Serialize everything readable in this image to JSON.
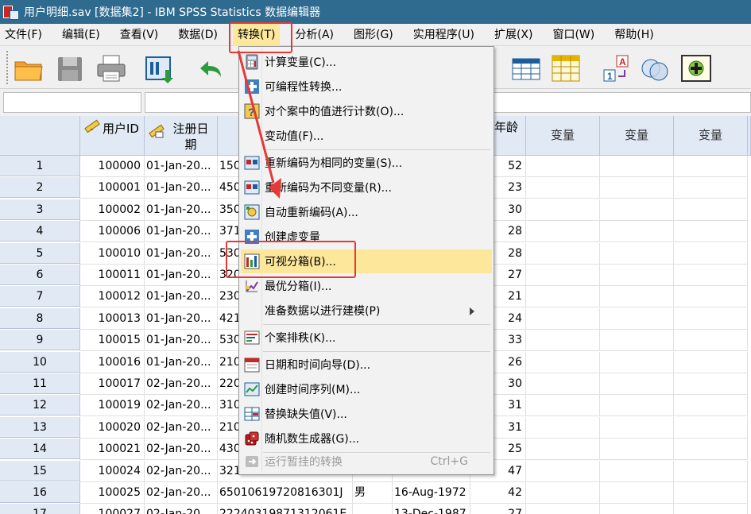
{
  "window": {
    "title": "用户明细.sav [数据集2] - IBM SPSS Statistics 数据编辑器"
  },
  "menubar": {
    "items": [
      {
        "label": "文件(F)"
      },
      {
        "label": "编辑(E)"
      },
      {
        "label": "查看(V)"
      },
      {
        "label": "数据(D)"
      },
      {
        "label": "转换(T)"
      },
      {
        "label": "分析(A)"
      },
      {
        "label": "图形(G)"
      },
      {
        "label": "实用程序(U)"
      },
      {
        "label": "扩展(X)"
      },
      {
        "label": "窗口(W)"
      },
      {
        "label": "帮助(H)"
      }
    ]
  },
  "grid": {
    "columns": [
      {
        "label": "用户ID",
        "icon": "ruler-icon"
      },
      {
        "label": "注册日\n期",
        "icon": "calendar-ruler-icon"
      },
      {
        "label": "",
        "icon": ""
      },
      {
        "label": "",
        "icon": ""
      },
      {
        "label": "",
        "icon": ""
      },
      {
        "label": "年龄",
        "icon": ""
      },
      {
        "label": "变量",
        "icon": ""
      },
      {
        "label": "变量",
        "icon": ""
      },
      {
        "label": "变量",
        "icon": ""
      }
    ],
    "rows": [
      {
        "n": "1",
        "id": "100000",
        "date": "01-Jan-20...",
        "c3": "150",
        "c4": "",
        "c5": "",
        "age": "52"
      },
      {
        "n": "2",
        "id": "100001",
        "date": "01-Jan-20...",
        "c3": "450",
        "c4": "",
        "c5": "",
        "age": "23"
      },
      {
        "n": "3",
        "id": "100002",
        "date": "01-Jan-20...",
        "c3": "350",
        "c4": "",
        "c5": "",
        "age": "30"
      },
      {
        "n": "4",
        "id": "100006",
        "date": "01-Jan-20...",
        "c3": "371",
        "c4": "",
        "c5": "",
        "age": "28"
      },
      {
        "n": "5",
        "id": "100010",
        "date": "01-Jan-20...",
        "c3": "530",
        "c4": "",
        "c5": "",
        "age": "28"
      },
      {
        "n": "6",
        "id": "100011",
        "date": "01-Jan-20...",
        "c3": "320",
        "c4": "",
        "c5": "",
        "age": "27"
      },
      {
        "n": "7",
        "id": "100012",
        "date": "01-Jan-20...",
        "c3": "230",
        "c4": "",
        "c5": "",
        "age": "21"
      },
      {
        "n": "8",
        "id": "100013",
        "date": "01-Jan-20...",
        "c3": "421",
        "c4": "",
        "c5": "",
        "age": "24"
      },
      {
        "n": "9",
        "id": "100015",
        "date": "01-Jan-20...",
        "c3": "530",
        "c4": "",
        "c5": "",
        "age": "33"
      },
      {
        "n": "10",
        "id": "100016",
        "date": "01-Jan-20...",
        "c3": "210",
        "c4": "",
        "c5": "",
        "age": "26"
      },
      {
        "n": "11",
        "id": "100017",
        "date": "02-Jan-20...",
        "c3": "220",
        "c4": "",
        "c5": "",
        "age": "30"
      },
      {
        "n": "12",
        "id": "100019",
        "date": "02-Jan-20...",
        "c3": "310",
        "c4": "",
        "c5": "",
        "age": "31"
      },
      {
        "n": "13",
        "id": "100020",
        "date": "02-Jan-20...",
        "c3": "210",
        "c4": "",
        "c5": "",
        "age": "31"
      },
      {
        "n": "14",
        "id": "100021",
        "date": "02-Jan-20...",
        "c3": "430",
        "c4": "",
        "c5": "",
        "age": "25"
      },
      {
        "n": "15",
        "id": "100024",
        "date": "02-Jan-20...",
        "c3": "321",
        "c4": "",
        "c5": "",
        "age": "47"
      },
      {
        "n": "16",
        "id": "100025",
        "date": "02-Jan-20...",
        "c3": "65010619720816301J",
        "c4": "男",
        "c5": "16-Aug-1972",
        "age": "42"
      },
      {
        "n": "17",
        "id": "100027",
        "date": "02-Jan-20...",
        "c3": "22240319871312061E",
        "c4": "",
        "c5": "13-Dec-1987",
        "age": "27"
      }
    ]
  },
  "dropdown": {
    "items": [
      {
        "label": "计算变量(C)...",
        "icon": "calculator-icon"
      },
      {
        "label": "可编程性转换...",
        "icon": "plus-box-icon"
      },
      {
        "label": "对个案中的值进行计数(O)...",
        "icon": "question-box-icon"
      },
      {
        "label": "变动值(F)...",
        "icon": ""
      },
      {
        "label": "重新编码为相同的变量(S)...",
        "icon": "recode-icon"
      },
      {
        "label": "重新编码为不同变量(R)...",
        "icon": "recode-icon"
      },
      {
        "label": "自动重新编码(A)...",
        "icon": "auto-recode-icon"
      },
      {
        "label": "创建虚变量",
        "icon": "plus-box-icon"
      },
      {
        "label": "可视分箱(B)...",
        "icon": "visual-binning-icon"
      },
      {
        "label": "最优分箱(I)...",
        "icon": "optimal-binning-icon"
      },
      {
        "label": "准备数据以进行建模(P)",
        "icon": ""
      },
      {
        "label": "个案排秩(K)...",
        "icon": "rank-cases-icon"
      },
      {
        "label": "日期和时间向导(D)...",
        "icon": "calendar-icon"
      },
      {
        "label": "创建时间序列(M)...",
        "icon": "time-series-icon"
      },
      {
        "label": "替换缺失值(V)...",
        "icon": "replace-missing-icon"
      },
      {
        "label": "随机数生成器(G)...",
        "icon": "dice-icon"
      },
      {
        "label": "运行暂挂的转换",
        "icon": "pending-transform-icon",
        "shortcut": "Ctrl+G"
      }
    ]
  },
  "colors": {
    "titlebar": "#2f6a8f",
    "highlight": "#fde79a",
    "annotation": "#e53935",
    "header": "#e1e9f4"
  }
}
